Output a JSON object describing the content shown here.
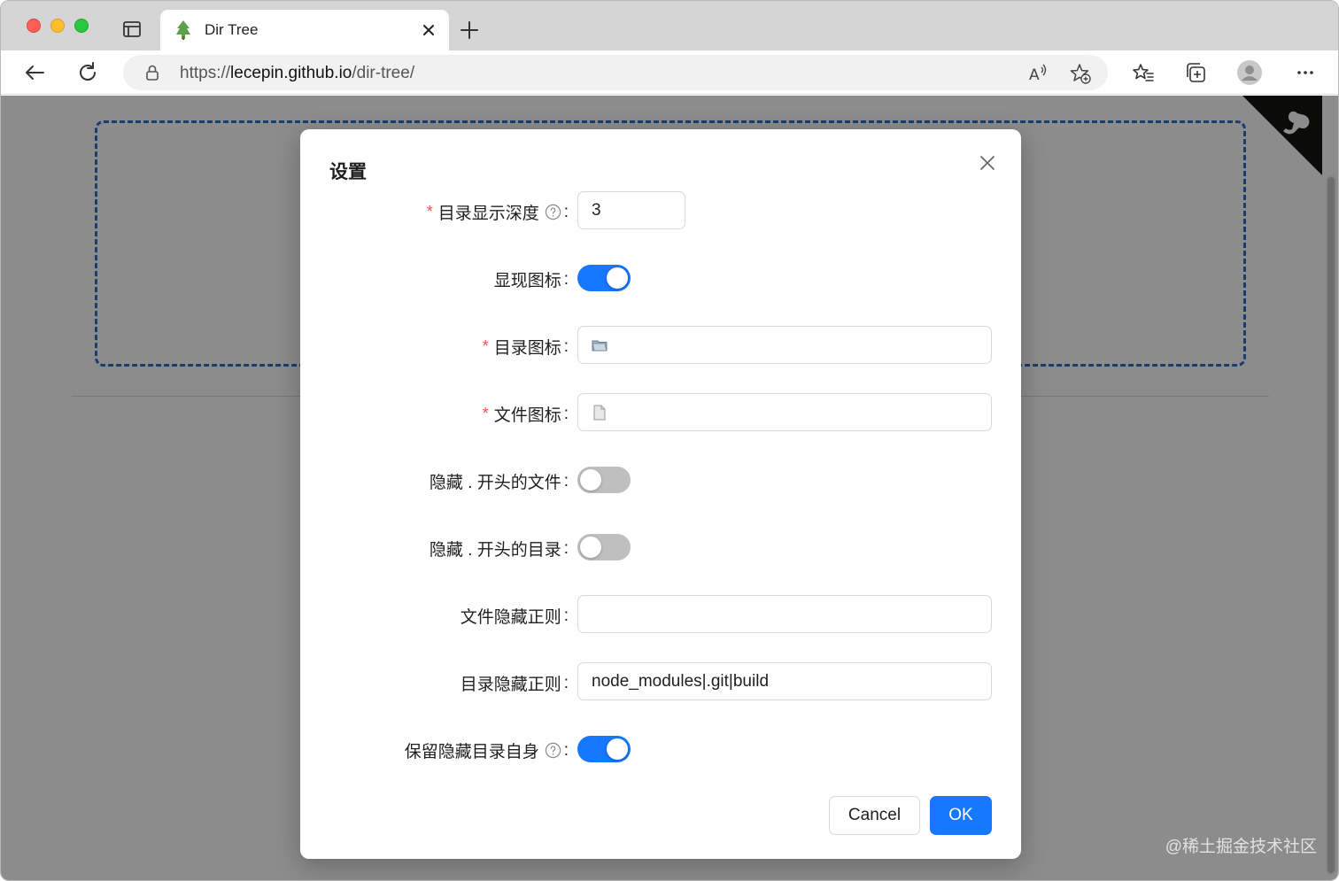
{
  "browser": {
    "tab_title": "Dir Tree",
    "url_scheme": "https://",
    "url_host": "lecepin.github.io",
    "url_path": "/dir-tree/"
  },
  "modal": {
    "title": "设置",
    "fields": {
      "depth": {
        "label": "目录显示深度",
        "required": true,
        "has_help": true,
        "value": "3"
      },
      "show_icons": {
        "label": "显现图标",
        "required": false,
        "checked": true
      },
      "dir_icon": {
        "label": "目录图标",
        "required": true,
        "value_icon": "folder-icon"
      },
      "file_icon": {
        "label": "文件图标",
        "required": true,
        "value_icon": "file-icon"
      },
      "hide_dot_files": {
        "label": "隐藏 . 开头的文件",
        "required": false,
        "checked": false
      },
      "hide_dot_dirs": {
        "label": "隐藏 . 开头的目录",
        "required": false,
        "checked": false
      },
      "file_hide_regex": {
        "label": "文件隐藏正则",
        "required": false,
        "value": ""
      },
      "dir_hide_regex": {
        "label": "目录隐藏正则",
        "required": false,
        "value": "node_modules|.git|build"
      },
      "keep_hidden_dir": {
        "label": "保留隐藏目录自身",
        "required": false,
        "has_help": true,
        "checked": true
      }
    },
    "colon": ":",
    "required_mark": "*",
    "cancel_label": "Cancel",
    "ok_label": "OK"
  },
  "watermark": "@稀土掘金技术社区",
  "colors": {
    "primary": "#1677ff",
    "required": "#ff4d4f",
    "dropzone_border": "#2f6fc6"
  }
}
